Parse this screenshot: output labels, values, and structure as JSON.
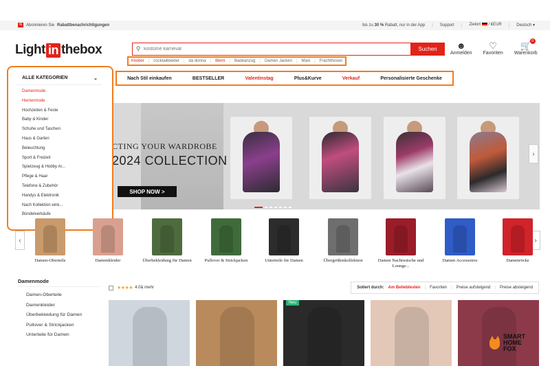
{
  "topbar": {
    "promo_prefix": "Abonnieren Sie",
    "promo_bold": "Rabattbenachrichtigungen",
    "app_promo_pre": "bis zu",
    "app_promo_bold": "30 %",
    "app_promo_post": "Rabatt, nur in der App",
    "support": "Support",
    "ship_label": "Zielort",
    "currency": "/ €EUR",
    "language": "Deutsch"
  },
  "header": {
    "logo_pre": "Light",
    "logo_in": "in",
    "logo_post": "thebox",
    "search_placeholder": "kostüme karneval",
    "search_button": "Suchen",
    "icons": [
      {
        "label": "Anmelden",
        "icon": "user-icon"
      },
      {
        "label": "Favoriten",
        "icon": "heart-icon"
      },
      {
        "label": "Warenkorb",
        "icon": "cart-icon",
        "badge": "0"
      }
    ],
    "hot_keywords": [
      "Kleider",
      "cocktailkleider",
      "da donna",
      "Bikini",
      "Badeanzug",
      "Damen Jacken",
      "Maxi",
      "Frachthosen"
    ]
  },
  "categories": {
    "title": "ALLE KATEGORIEN",
    "items": [
      {
        "label": "Damenmode",
        "active": true
      },
      {
        "label": "Herrenmode",
        "active": true
      },
      {
        "label": "Hochzeiten & Feste"
      },
      {
        "label": "Baby & Kinder"
      },
      {
        "label": "Schuhe und Taschen"
      },
      {
        "label": "Haus & Garten"
      },
      {
        "label": "Beleuchtung"
      },
      {
        "label": "Sport & Freizeit"
      },
      {
        "label": "Spielzeug & Hobby Ar..."
      },
      {
        "label": "Pflege & Haar"
      },
      {
        "label": "Telefone & Zubehör"
      },
      {
        "label": "Handys & Elektronik"
      },
      {
        "label": "Nach Kollektion eink..."
      },
      {
        "label": "Bündelverkäufe"
      }
    ]
  },
  "nav": [
    {
      "label": "Nach Stil einkaufen",
      "red": false
    },
    {
      "label": "BESTSELLER",
      "red": false
    },
    {
      "label": "Valentinstag",
      "red": true
    },
    {
      "label": "Plus&Kurve",
      "red": false
    },
    {
      "label": "Verkauf",
      "red": true
    },
    {
      "label": "Personalisierte Geschenke",
      "red": false
    }
  ],
  "hero": {
    "line1": "CTING YOUR WARDROBE",
    "line2": "2024 COLLECTION",
    "button": "SHOP NOW >"
  },
  "thumbs": [
    {
      "label": "Damen-Oberteile",
      "color": "#c99a6c"
    },
    {
      "label": "Damenkleider",
      "color": "#d9a08f"
    },
    {
      "label": "Überbekleidung für Damen",
      "color": "#4e6b3e"
    },
    {
      "label": "Pullover & Strickjacken",
      "color": "#3f6b3a"
    },
    {
      "label": "Unterteile für Damen",
      "color": "#2c2c2c"
    },
    {
      "label": "Übergrößenkollektion",
      "color": "#6e6e6e"
    },
    {
      "label": "Damen Nachtwäsche und Lounge...",
      "color": "#9b1d2a"
    },
    {
      "label": "Damen Accessoires",
      "color": "#2f5cc7"
    },
    {
      "label": "Damenröcke",
      "color": "#d1232a"
    }
  ],
  "sidebar": {
    "heading": "Damenmode",
    "items": [
      "Damen-Oberteile",
      "Damenkleider",
      "Überbekleidung für Damen",
      "Pullover & Strickjacken",
      "Unterteile für Damen"
    ]
  },
  "filter": {
    "rating_text": "4.0& mehr",
    "sort_label": "Sotiert durch:",
    "sort_active": "Am Beliebtesten",
    "sort_options": [
      "Favoriten",
      "Preise aufsteigend",
      "Preise absteigend"
    ]
  },
  "products": [
    {
      "color": "#cfd6de",
      "new": false
    },
    {
      "color": "#b98a5c",
      "new": false
    },
    {
      "color": "#2a2a2a",
      "new": true
    },
    {
      "color": "#e3c8b8",
      "new": false
    },
    {
      "color": "#8c3a4a",
      "new": false
    }
  ],
  "watermark": {
    "line1": "SMART",
    "line2": "HOME",
    "line3": "FOX"
  },
  "colors": {
    "accent": "#e2231a",
    "highlight_box": "#f07c1e"
  }
}
